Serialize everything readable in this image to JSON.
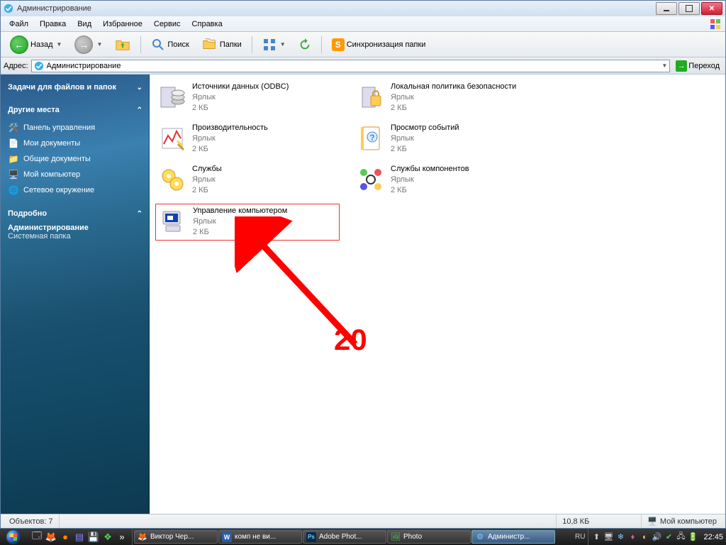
{
  "window": {
    "title": "Администрирование"
  },
  "menubar": [
    "Файл",
    "Правка",
    "Вид",
    "Избранное",
    "Сервис",
    "Справка"
  ],
  "toolbar": {
    "back": "Назад",
    "search": "Поиск",
    "folders": "Папки",
    "sync": "Синхронизация папки"
  },
  "address": {
    "label": "Адрес:",
    "value": "Администрирование",
    "go": "Переход"
  },
  "sidebar": {
    "panels": {
      "fileTasks": {
        "title": "Задачи для файлов и папок"
      },
      "otherPlaces": {
        "title": "Другие места",
        "items": [
          {
            "icon": "panel",
            "label": "Панель управления"
          },
          {
            "icon": "mydocs",
            "label": "Мои документы"
          },
          {
            "icon": "shared",
            "label": "Общие документы"
          },
          {
            "icon": "mycomp",
            "label": "Мой компьютер"
          },
          {
            "icon": "network",
            "label": "Сетевое окружение"
          }
        ]
      },
      "details": {
        "title": "Подробно",
        "name": "Администрирование",
        "desc": "Системная папка"
      }
    }
  },
  "files": [
    {
      "name": "Источники данных (ODBC)",
      "type": "Ярлык",
      "size": "2 КБ",
      "icon": "odbc"
    },
    {
      "name": "Локальная политика безопасности",
      "type": "Ярлык",
      "size": "2 КБ",
      "icon": "lock"
    },
    {
      "name": "Производительность",
      "type": "Ярлык",
      "size": "2 КБ",
      "icon": "perf"
    },
    {
      "name": "Просмотр событий",
      "type": "Ярлык",
      "size": "2 КБ",
      "icon": "events"
    },
    {
      "name": "Службы",
      "type": "Ярлык",
      "size": "2 КБ",
      "icon": "services"
    },
    {
      "name": "Службы компонентов",
      "type": "Ярлык",
      "size": "2 КБ",
      "icon": "comsvc"
    },
    {
      "name": "Управление компьютером",
      "type": "Ярлык",
      "size": "2 КБ",
      "icon": "compmgmt",
      "selected": true
    }
  ],
  "statusbar": {
    "objects": "Объектов: 7",
    "size": "10,8 КБ",
    "location": "Мой компьютер"
  },
  "annotation": {
    "label": "20"
  },
  "taskbar": {
    "tasks": [
      {
        "label": "Виктор Чер...",
        "icon": "ff"
      },
      {
        "label": "комп не ви...",
        "icon": "word"
      },
      {
        "label": "Adobe Phot...",
        "icon": "ps"
      },
      {
        "label": "Photo",
        "icon": "photo"
      },
      {
        "label": "Администр...",
        "icon": "admin",
        "active": true
      }
    ],
    "lang": "RU",
    "clock": "22:45"
  }
}
